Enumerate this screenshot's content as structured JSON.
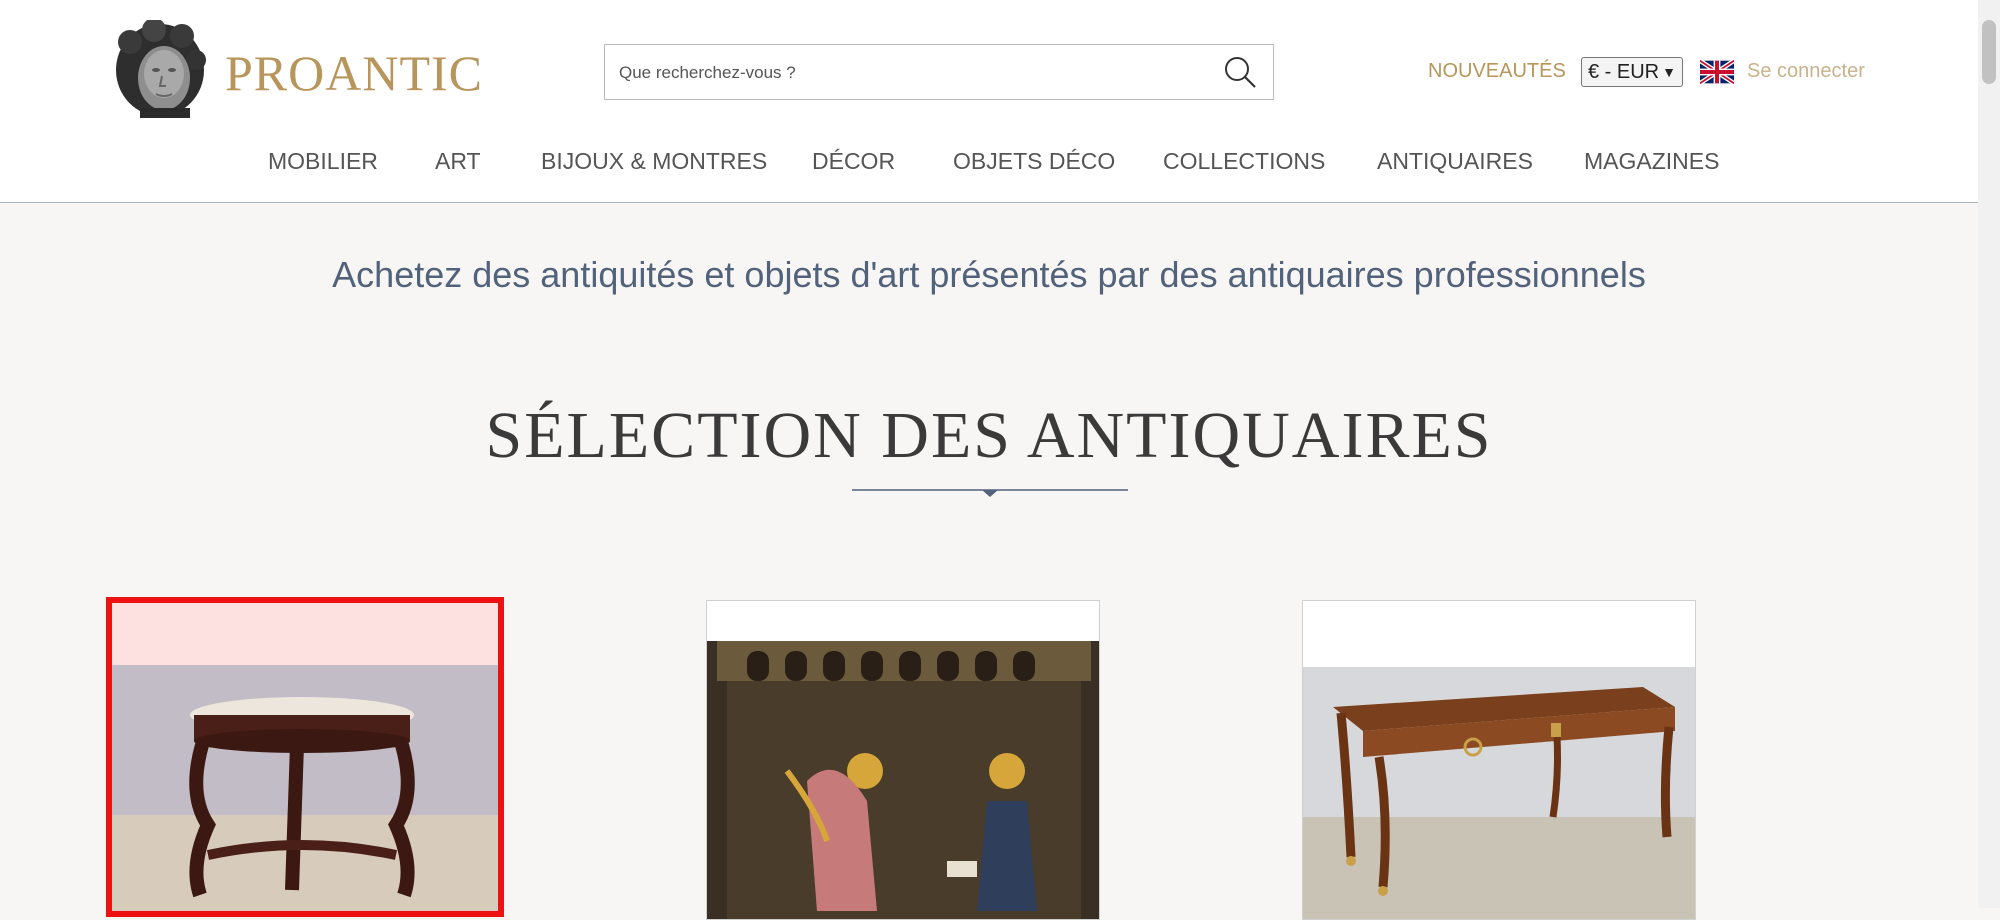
{
  "header": {
    "logo_text": "PROANTIC",
    "search": {
      "placeholder": "Que recherchez-vous ?"
    },
    "nouveautes_label": "NOUVEAUTÉS",
    "currency": "€ - EUR",
    "login_label": "Se connecter"
  },
  "nav": {
    "items": [
      {
        "label": "MOBILIER"
      },
      {
        "label": "ART"
      },
      {
        "label": "BIJOUX & MONTRES"
      },
      {
        "label": "DÉCOR"
      },
      {
        "label": "OBJETS DÉCO"
      },
      {
        "label": "COLLECTIONS"
      },
      {
        "label": "ANTIQUAIRES"
      },
      {
        "label": "MAGAZINES"
      }
    ]
  },
  "main": {
    "tagline": "Achetez des antiquités et objets d'art présentés par des antiquaires professionnels",
    "section_title": "SÉLECTION DES ANTIQUAIRES"
  },
  "colors": {
    "brand_gold": "#b8955a",
    "login_gold": "#c9b28c",
    "tagline_blue": "#51627a",
    "selection_red": "#ee1111"
  }
}
